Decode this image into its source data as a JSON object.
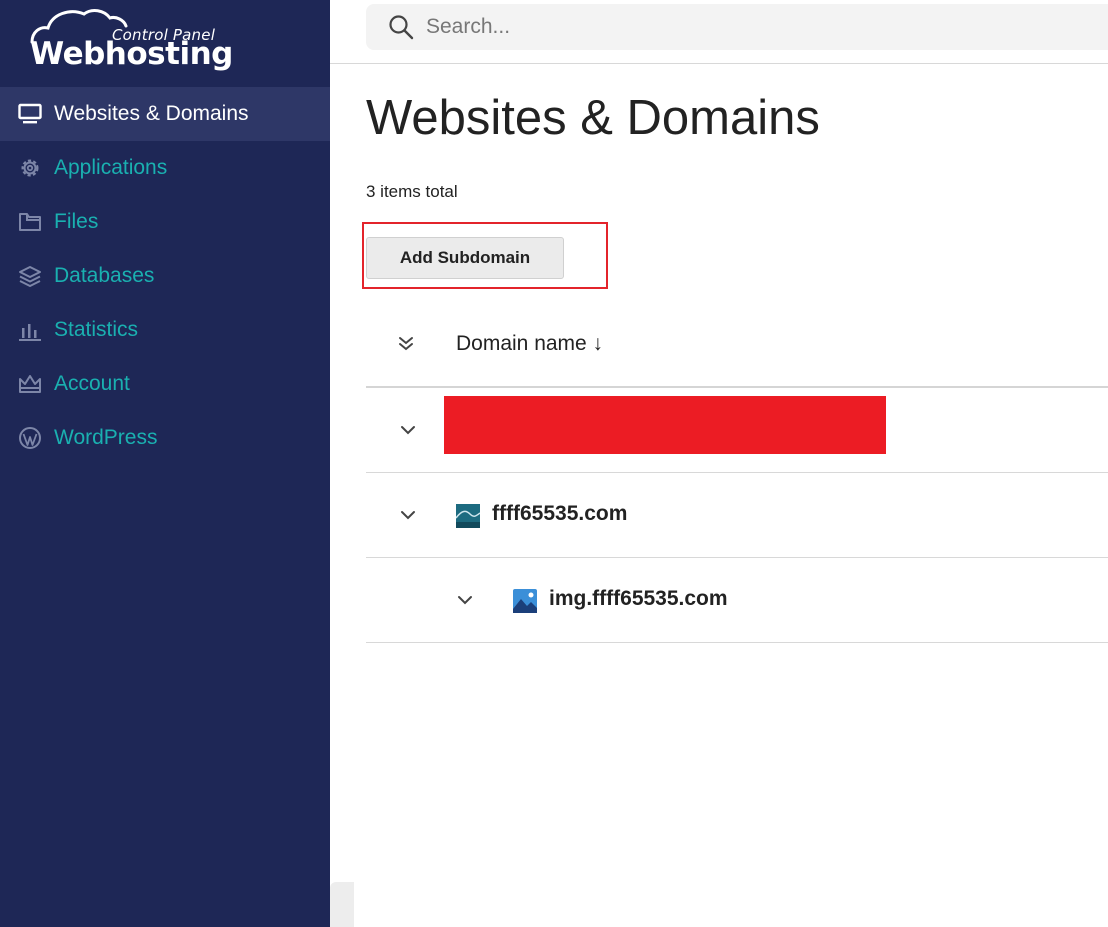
{
  "brand": {
    "top_text": "Control Panel",
    "main_text": "Webhosting"
  },
  "colors": {
    "sidebar_bg": "#1e2756",
    "sidebar_active": "#2e3767",
    "accent_teal": "#1ab0b0",
    "highlight_red": "#e3242b",
    "redact_red": "#ec1c24"
  },
  "sidebar": {
    "items": [
      {
        "label": "Websites & Domains",
        "icon": "monitor-icon",
        "active": true
      },
      {
        "label": "Applications",
        "icon": "gear-icon",
        "active": false
      },
      {
        "label": "Files",
        "icon": "folder-icon",
        "active": false
      },
      {
        "label": "Databases",
        "icon": "layers-icon",
        "active": false
      },
      {
        "label": "Statistics",
        "icon": "bar-chart-icon",
        "active": false
      },
      {
        "label": "Account",
        "icon": "crown-icon",
        "active": false
      },
      {
        "label": "WordPress",
        "icon": "wordpress-icon",
        "active": false
      }
    ]
  },
  "search": {
    "placeholder": "Search..."
  },
  "page": {
    "title": "Websites & Domains",
    "count_text": "3 items total"
  },
  "toolbar": {
    "add_subdomain_label": "Add Subdomain"
  },
  "table": {
    "column_header": "Domain name ↓",
    "rows": [
      {
        "name": "",
        "redacted": true,
        "level": 0
      },
      {
        "name": "ffff65535.com",
        "redacted": false,
        "level": 0,
        "icon": "site-thumbnail-icon"
      },
      {
        "name": "img.ffff65535.com",
        "redacted": false,
        "level": 1,
        "icon": "image-icon"
      }
    ]
  }
}
